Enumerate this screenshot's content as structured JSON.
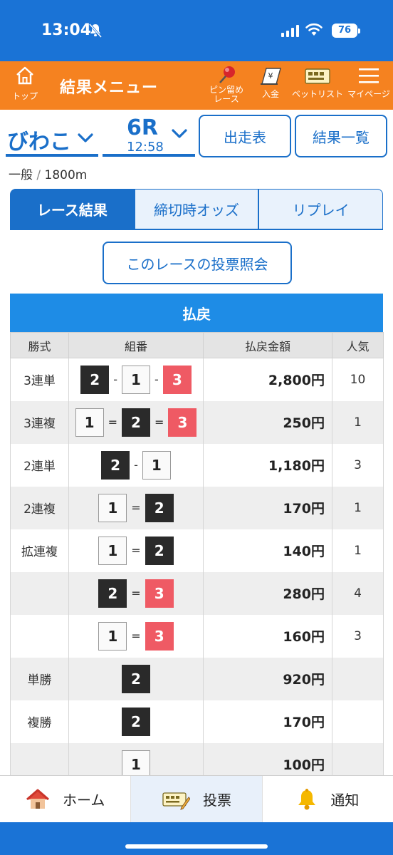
{
  "status_bar": {
    "time": "13:04",
    "battery": "76"
  },
  "header": {
    "home_label": "トップ",
    "title": "結果メニュー",
    "pin_label_1": "ピン留め",
    "pin_label_2": "レース",
    "deposit_label": "入金",
    "betlist_label": "ベットリスト",
    "mypage_label": "マイページ",
    "colors": {
      "accent": "#f58220",
      "brand": "#1a73d6"
    }
  },
  "race": {
    "venue": "びわこ",
    "race_number": "6R",
    "start_time": "12:58",
    "entries_button": "出走表",
    "results_list_button": "結果一覧",
    "grade": "一般",
    "separator": "/",
    "distance": "1800m"
  },
  "tabs": [
    {
      "label": "レース結果",
      "active": true
    },
    {
      "label": "締切時オッズ",
      "active": false
    },
    {
      "label": "リプレイ",
      "active": false
    }
  ],
  "inquiry_button": "このレースの投票照会",
  "payout": {
    "title": "払戻",
    "headers": {
      "type": "勝式",
      "combo": "組番",
      "amount": "払戻金額",
      "popularity": "人気"
    },
    "rows": [
      {
        "type": "3連単",
        "boats": [
          "2",
          "1",
          "3"
        ],
        "seps": [
          "-",
          "-"
        ],
        "amount": "2,800円",
        "popularity": "10"
      },
      {
        "type": "3連複",
        "boats": [
          "1",
          "2",
          "3"
        ],
        "seps": [
          "=",
          "="
        ],
        "amount": "250円",
        "popularity": "1"
      },
      {
        "type": "2連単",
        "boats": [
          "2",
          "1"
        ],
        "seps": [
          "-"
        ],
        "amount": "1,180円",
        "popularity": "3"
      },
      {
        "type": "2連複",
        "boats": [
          "1",
          "2"
        ],
        "seps": [
          "="
        ],
        "amount": "170円",
        "popularity": "1"
      },
      {
        "type": "拡連複",
        "boats": [
          "1",
          "2"
        ],
        "seps": [
          "="
        ],
        "amount": "140円",
        "popularity": "1"
      },
      {
        "type": "",
        "boats": [
          "2",
          "3"
        ],
        "seps": [
          "="
        ],
        "amount": "280円",
        "popularity": "4"
      },
      {
        "type": "",
        "boats": [
          "1",
          "3"
        ],
        "seps": [
          "="
        ],
        "amount": "160円",
        "popularity": "3"
      },
      {
        "type": "単勝",
        "boats": [
          "2"
        ],
        "seps": [],
        "amount": "920円",
        "popularity": ""
      },
      {
        "type": "複勝",
        "boats": [
          "2"
        ],
        "seps": [],
        "amount": "170円",
        "popularity": ""
      },
      {
        "type": "",
        "boats": [
          "1"
        ],
        "seps": [],
        "amount": "100円",
        "popularity": ""
      }
    ]
  },
  "boat_colors": {
    "1": "#fafafa",
    "2": "#2a2a2a",
    "3": "#ef5a64"
  },
  "bottom_nav": [
    {
      "label": "ホーム",
      "icon": "house-icon"
    },
    {
      "label": "投票",
      "icon": "ticket-icon",
      "active": true
    },
    {
      "label": "通知",
      "icon": "bell-icon"
    }
  ]
}
